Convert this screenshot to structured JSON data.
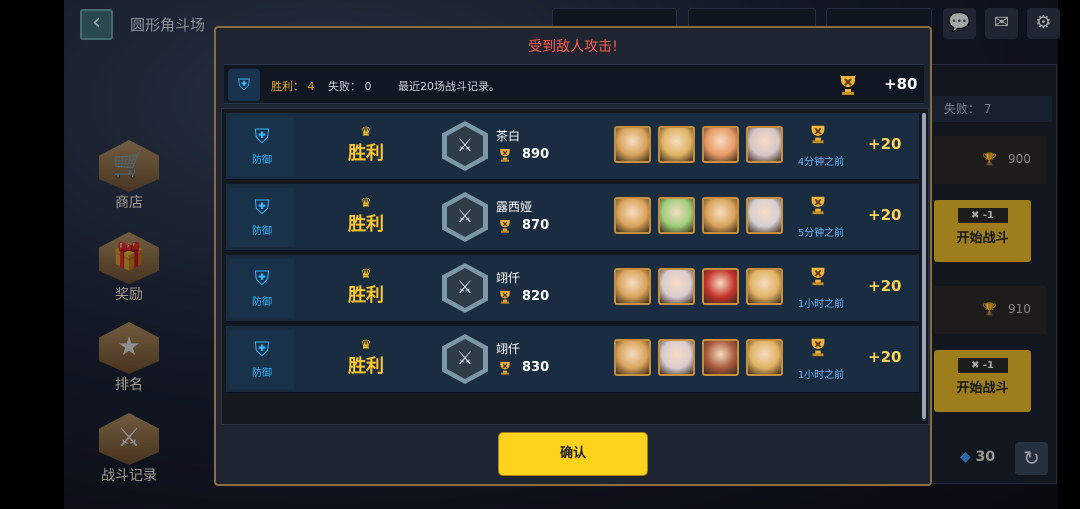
{
  "header": {
    "page_title": "圆形角斗场",
    "back_icon": "back-arrow-icon",
    "chat_icon": "chat-icon",
    "mail_icon": "mail-icon",
    "settings_icon": "gear-icon"
  },
  "side_menu": [
    {
      "label": "商店",
      "icon": "shop-cart-icon"
    },
    {
      "label": "奖励",
      "icon": "gift-icon"
    },
    {
      "label": "排名",
      "icon": "ranking-icon"
    },
    {
      "label": "战斗记录",
      "icon": "battle-record-icon"
    }
  ],
  "right_panel": {
    "lose_label": "失败：",
    "lose_count": "7",
    "opponents": [
      {
        "trophy_score": "900",
        "ticket_cost": "-1",
        "button_label": "开始战斗"
      },
      {
        "trophy_score": "910",
        "ticket_cost": "-1",
        "button_label": "开始战斗"
      }
    ],
    "gem_count": "30"
  },
  "modal": {
    "title": "受到敌人攻击!",
    "summary": {
      "win_label": "胜利：",
      "win_count": "4",
      "lose_label": "失败：",
      "lose_count": "0",
      "record_note": "最近20场战斗记录。",
      "total_gain": "+80"
    },
    "records": [
      {
        "type": "防御",
        "result": "胜利",
        "name": "茶白",
        "score": "890",
        "time": "4分钟之前",
        "points": "+20",
        "heroes": [
          "#d9a35a",
          "#e0b262",
          "#e89a66",
          "#d6c5c8"
        ]
      },
      {
        "type": "防御",
        "result": "胜利",
        "name": "露西娅",
        "score": "870",
        "time": "5分钟之前",
        "points": "+20",
        "heroes": [
          "#dba35a",
          "#9fce7c",
          "#d9a35a",
          "#d7d0d2"
        ]
      },
      {
        "type": "防御",
        "result": "胜利",
        "name": "翊仟",
        "score": "820",
        "time": "1小时之前",
        "points": "+20",
        "heroes": [
          "#d9a35a",
          "#d9ccd0",
          "#c6332c",
          "#e0b262"
        ]
      },
      {
        "type": "防御",
        "result": "胜利",
        "name": "翊仟",
        "score": "830",
        "time": "1小时之前",
        "points": "+20",
        "heroes": [
          "#d9a35a",
          "#d9ccd0",
          "#a8593a",
          "#e0b262"
        ]
      }
    ],
    "confirm_label": "确认"
  },
  "colors": {
    "accent_gold": "#ffc62d",
    "title_red": "#ff5a4a",
    "time_blue": "#6fb6ff",
    "defense_blue": "#36b5ff"
  }
}
